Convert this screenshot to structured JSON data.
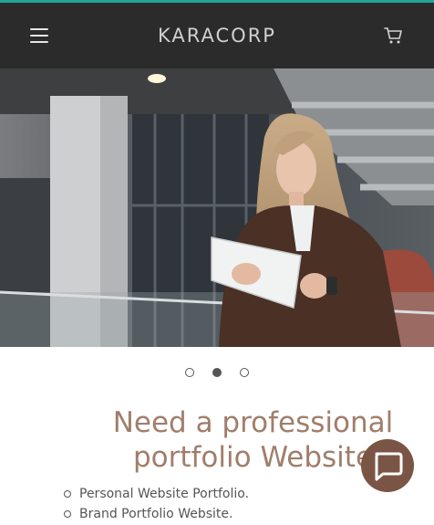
{
  "colors": {
    "accent_line": "#1fa39a",
    "header_bg": "#2b2b2b",
    "heading": "#a07e6b",
    "chat_button": "#7a5545"
  },
  "header": {
    "brand": "KARACORP",
    "menu_icon": "hamburger-menu-icon",
    "cart_icon": "shopping-cart-icon"
  },
  "hero": {
    "image": "woman holding tablet in modern building",
    "slides": 3,
    "active_slide": 2
  },
  "main": {
    "heading_line1": "Need a professional",
    "heading_line2": "portfolio Website",
    "features": [
      "Personal Website Portfolio.",
      "Brand Portfolio Website."
    ]
  },
  "chat": {
    "icon": "chat-bubble-icon"
  }
}
